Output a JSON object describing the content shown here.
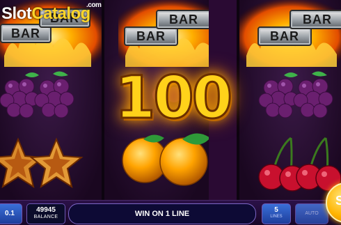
{
  "watermark": {
    "brand_a": "Slot",
    "brand_b": "Catalog",
    "tld": ".com"
  },
  "reels": {
    "bar_label": "BAR",
    "rows": [
      "bar",
      "grapes",
      "star / orange / cherry"
    ]
  },
  "win": {
    "amount": "100"
  },
  "panel": {
    "bet_value": "0.1",
    "balance_value": "49945",
    "balance_label": "BALANCE",
    "message": "WIN ON 1 LINE",
    "lines_value": "5",
    "lines_label": "LINES",
    "auto_label": "AUTO",
    "spin_label": "S"
  },
  "colors": {
    "win_text": "#ffd21a",
    "panel_bg": "#1e0a33",
    "reel_bg": "#2a0a33"
  }
}
